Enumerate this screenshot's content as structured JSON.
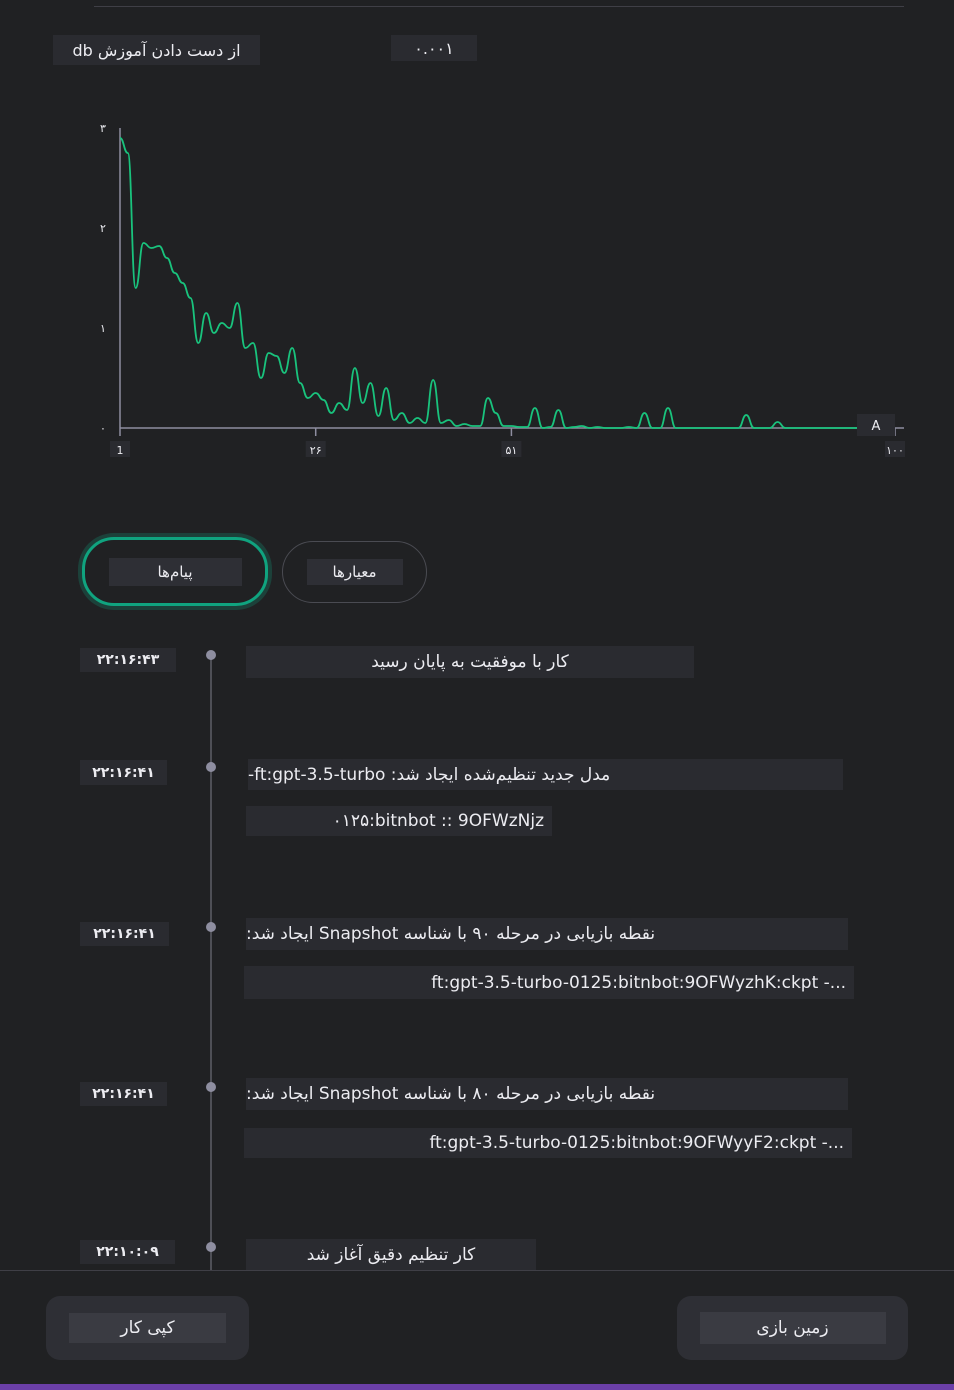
{
  "header": {
    "loss_label": "از دست دادن آموزش db",
    "loss_value": "۰.۰۰۱"
  },
  "chart_data": {
    "type": "line",
    "y_ticks": [
      "۰",
      "۱",
      "۲",
      "۳"
    ],
    "x_ticks": [
      "1",
      "۲۶",
      "۵۱",
      "۱۰۰"
    ],
    "marker_label": "A",
    "ylim": [
      0,
      3
    ],
    "xlim": [
      1,
      100
    ],
    "color": "#19c37d",
    "series": [
      {
        "x": [
          1,
          2,
          3,
          4,
          5,
          6,
          7,
          8,
          9,
          10,
          11,
          12,
          13,
          14,
          15,
          16,
          17,
          18,
          19,
          20,
          21,
          22,
          23,
          24,
          25,
          26,
          27,
          28,
          29,
          30,
          31,
          32,
          33,
          34,
          35,
          36,
          37,
          38,
          39,
          40,
          41,
          42,
          43,
          44,
          45,
          46,
          47,
          48,
          49,
          50,
          51,
          52,
          53,
          54,
          55,
          56,
          57,
          58,
          59,
          60,
          61,
          62,
          63,
          64,
          65,
          66,
          67,
          68,
          69,
          70,
          71,
          72,
          73,
          74,
          75,
          76,
          77,
          78,
          79,
          80,
          81,
          82,
          83,
          84,
          85,
          86,
          87,
          88,
          89,
          90,
          91,
          92,
          93,
          94,
          95,
          96,
          97,
          98,
          99,
          100
        ],
        "y": [
          2.9,
          2.75,
          1.4,
          1.85,
          1.8,
          1.82,
          1.7,
          1.55,
          1.45,
          1.3,
          0.85,
          1.15,
          0.95,
          1.05,
          1.0,
          1.25,
          0.8,
          0.85,
          0.5,
          0.75,
          0.72,
          0.55,
          0.8,
          0.45,
          0.3,
          0.35,
          0.28,
          0.15,
          0.25,
          0.18,
          0.6,
          0.25,
          0.45,
          0.12,
          0.4,
          0.08,
          0.15,
          0.05,
          0.1,
          0.05,
          0.48,
          0.05,
          0.08,
          0.02,
          0.04,
          0.02,
          0.02,
          0.3,
          0.15,
          0.02,
          0.02,
          0.01,
          0.01,
          0.2,
          0.0,
          0.01,
          0.18,
          0.0,
          0.01,
          0.02,
          0.0,
          0.01,
          0.0,
          0.0,
          0.0,
          0.01,
          0.0,
          0.15,
          0.0,
          0.0,
          0.2,
          0.0,
          0.0,
          0.0,
          0.0,
          0.0,
          0.0,
          0.0,
          0.0,
          0.0,
          0.13,
          0.0,
          0.0,
          0.0,
          0.06,
          0.0,
          0.0,
          0.0,
          0.0,
          0.0,
          0.0,
          0.0,
          0.0,
          0.0,
          0.0,
          0.0,
          0.0,
          0.0,
          0.0,
          0.0
        ]
      }
    ]
  },
  "tabs": [
    {
      "label": "پیام‌ها",
      "active": true
    },
    {
      "label": "معیارها",
      "active": false
    }
  ],
  "events": [
    {
      "time": "۲۲:۱۶:۴۳",
      "lines": [
        "کار با موفقیت به پایان رسید"
      ]
    },
    {
      "time": "۲۲:۱۶:۴۱",
      "lines": [
        "مدل جدید تنظیم‌شده ایجاد شد: ft:gpt-3.5-turbo-",
        "۰۱۲۵:bitnbot :: 9OFWzNjz"
      ]
    },
    {
      "time": "۲۲:۱۶:۴۱",
      "lines": [
        "نقطه بازیابی در مرحله ۹۰ با شناسه Snapshot ایجاد شد:",
        "ft:gpt-3.5-turbo-0125:bitnbot:9OFWyzhK:ckpt -..."
      ]
    },
    {
      "time": "۲۲:۱۶:۴۱",
      "lines": [
        "نقطه بازیابی در مرحله ۸۰ با شناسه Snapshot ایجاد شد:",
        "ft:gpt-3.5-turbo-0125:bitnbot:9OFWyyF2:ckpt -..."
      ]
    },
    {
      "time": "۲۲:۱۰:۰۹",
      "lines": [
        "کار تنظیم دقیق آغاز شد"
      ]
    }
  ],
  "footer": {
    "copy_label": "کپی کار",
    "playground_label": "زمین بازی"
  }
}
